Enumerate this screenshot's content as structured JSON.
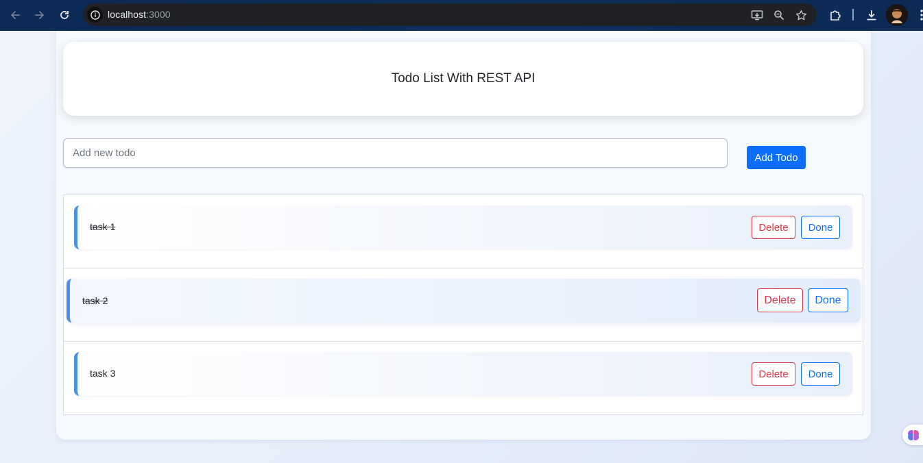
{
  "browser": {
    "url_host": "localhost",
    "url_port": ":3000"
  },
  "header": {
    "title": "Todo List With REST API"
  },
  "form": {
    "placeholder": "Add new todo",
    "value": "",
    "add_label": "Add Todo"
  },
  "todos": [
    {
      "text": "task 1",
      "completed": true,
      "delete_label": "Delete",
      "done_label": "Done"
    },
    {
      "text": "task 2",
      "completed": true,
      "delete_label": "Delete",
      "done_label": "Done"
    },
    {
      "text": "task 3",
      "completed": false,
      "delete_label": "Delete",
      "done_label": "Done"
    }
  ],
  "colors": {
    "accent": "#4a90e2",
    "primary": "#0d6efd",
    "danger": "#dc3545",
    "browser_bar": "#0d2f5e"
  },
  "icons": {
    "back": "arrow-left-icon",
    "forward": "arrow-right-icon",
    "reload": "reload-icon",
    "site_info": "info-icon",
    "install": "install-app-icon",
    "zoom": "zoom-icon",
    "bookmark": "star-icon",
    "extensions": "puzzle-icon",
    "download": "download-icon",
    "menu": "kebab-menu-icon"
  }
}
